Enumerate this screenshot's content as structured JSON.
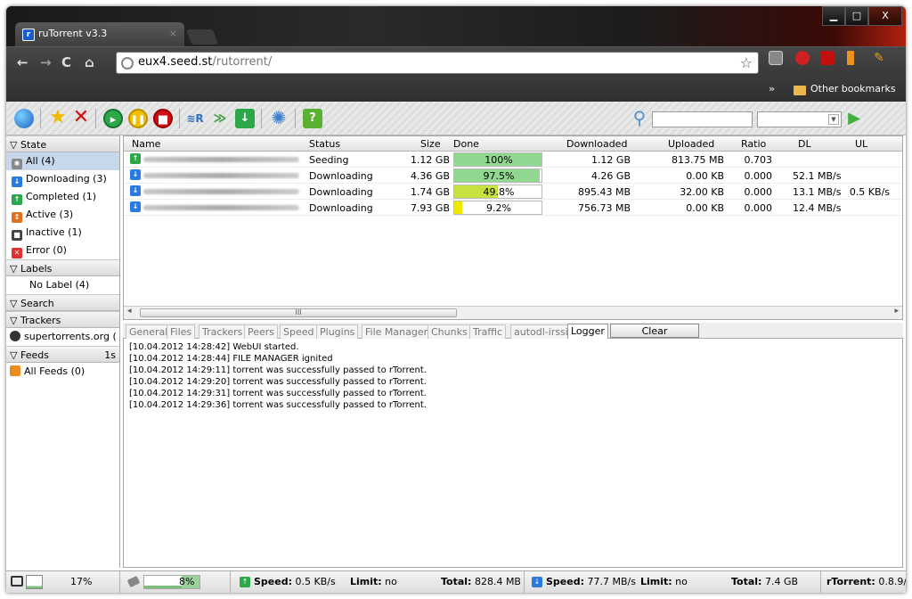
{
  "browser": {
    "tab_title": "ruTorrent v3.3",
    "tab_close": "×",
    "url_host": "eux4.seed.st",
    "url_path": "/rutorrent/",
    "other_bookmarks": "Other bookmarks",
    "bookmarks_chevron": "»",
    "window_minimize": "▁",
    "window_maximize": "□",
    "window_close": "X"
  },
  "sidebar": {
    "state_header": "State",
    "state_items": [
      {
        "label": "All (4)",
        "color": "#888888",
        "glyph": "✱"
      },
      {
        "label": "Downloading (3)",
        "color": "#2a7be0",
        "glyph": "↓"
      },
      {
        "label": "Completed (1)",
        "color": "#2aa84a",
        "glyph": "↑"
      },
      {
        "label": "Active (3)",
        "color": "#e07020",
        "glyph": "↕"
      },
      {
        "label": "Inactive (1)",
        "color": "#444444",
        "glyph": "■"
      },
      {
        "label": "Error (0)",
        "color": "#e03030",
        "glyph": "✕"
      }
    ],
    "labels_header": "Labels",
    "no_label": "No Label (4)",
    "search_header": "Search",
    "trackers_header": "Trackers",
    "tracker_item": "supertorrents.org (",
    "feeds_header": "Feeds",
    "feeds_interval": "1s",
    "all_feeds": "All Feeds (0)"
  },
  "table": {
    "columns": [
      "Name",
      "Status",
      "Size",
      "Done",
      "Downloaded",
      "Uploaded",
      "Ratio",
      "DL",
      "UL"
    ],
    "rows": [
      {
        "status": "Seeding",
        "size": "1.12 GB",
        "done": "100%",
        "done_frac": 1.0,
        "bar_color": "#90d890",
        "downloaded": "1.12 GB",
        "uploaded": "813.75 MB",
        "ratio": "0.703",
        "dl": "",
        "ul": "",
        "icon_color": "#2aa84a",
        "icon": "↑"
      },
      {
        "status": "Downloading",
        "size": "4.36 GB",
        "done": "97.5%",
        "done_frac": 0.975,
        "bar_color": "#90d890",
        "downloaded": "4.26 GB",
        "uploaded": "0.00 KB",
        "ratio": "0.000",
        "dl": "52.1 MB/s",
        "ul": "",
        "icon_color": "#2a7be0",
        "icon": "↓"
      },
      {
        "status": "Downloading",
        "size": "1.74 GB",
        "done": "49.8%",
        "done_frac": 0.498,
        "bar_color": "#c8e040",
        "downloaded": "895.43 MB",
        "uploaded": "32.00 KB",
        "ratio": "0.000",
        "dl": "13.1 MB/s",
        "ul": "0.5 KB/s",
        "icon_color": "#2a7be0",
        "icon": "↓"
      },
      {
        "status": "Downloading",
        "size": "7.93 GB",
        "done": "9.2%",
        "done_frac": 0.092,
        "bar_color": "#f0e800",
        "downloaded": "756.73 MB",
        "uploaded": "0.00 KB",
        "ratio": "0.000",
        "dl": "12.4 MB/s",
        "ul": "",
        "icon_color": "#2a7be0",
        "icon": "↓"
      }
    ],
    "scroll_grip": "III"
  },
  "bottom_tabs": [
    "General",
    "Files",
    "Trackers",
    "Peers",
    "Speed",
    "Plugins",
    "File Manager",
    "Chunks",
    "Traffic",
    "autodl-irssi",
    "Logger"
  ],
  "clear_button": "Clear",
  "log_lines": [
    "[10.04.2012 14:28:42] WebUI started.",
    "[10.04.2012 14:28:44] FILE MANAGER ignited",
    "[10.04.2012 14:29:11] torrent was successfully passed to rTorrent.",
    "[10.04.2012 14:29:20] torrent was successfully passed to rTorrent.",
    "[10.04.2012 14:29:31] torrent was successfully passed to rTorrent.",
    "[10.04.2012 14:29:36] torrent was successfully passed to rTorrent."
  ],
  "statusbar": {
    "cpu": "17%",
    "disk": "8%",
    "up_speed_label": "Speed:",
    "up_speed": "0.5 KB/s",
    "up_limit_label": "Limit:",
    "up_limit": "no",
    "up_total_label": "Total:",
    "up_total": "828.4 MB",
    "down_speed_label": "Speed:",
    "down_speed": "77.7 MB/s",
    "down_limit_label": "Limit:",
    "down_limit": "no",
    "down_total_label": "Total:",
    "down_total": "7.4 GB",
    "version_label": "rTorrent:",
    "version": "0.8.9/"
  }
}
